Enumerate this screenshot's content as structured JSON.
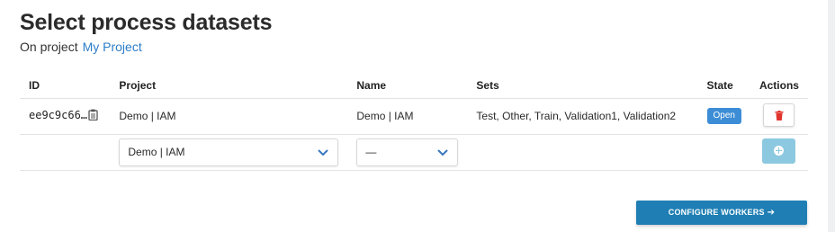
{
  "header": {
    "title": "Select process datasets",
    "project_prefix": "On project",
    "project_link": "My Project"
  },
  "table": {
    "columns": {
      "id": "ID",
      "project": "Project",
      "name": "Name",
      "sets": "Sets",
      "state": "State",
      "actions": "Actions"
    },
    "rows": [
      {
        "id": "ee9c9c66…",
        "project": "Demo | IAM",
        "name": "Demo | IAM",
        "sets": "Test, Other, Train, Validation1, Validation2",
        "state": "Open"
      }
    ],
    "new_row": {
      "project_select_value": "Demo | IAM",
      "name_select_value": "—"
    }
  },
  "footer": {
    "configure_label": "CONFIGURE WORKERS",
    "configure_arrow": "➔"
  },
  "icons": {
    "copy": "clipboard-icon",
    "delete": "trash-icon",
    "dropdown": "chevron-down-icon",
    "add": "plus-circle-icon",
    "next": "arrow-right-icon"
  },
  "colors": {
    "link": "#2b7cc7",
    "state_tag": "#3c8dd6",
    "delete_icon": "#e0332c",
    "chevron": "#3a78c0",
    "add_button": "#8cc8e0",
    "primary_button": "#1f7fb4"
  }
}
